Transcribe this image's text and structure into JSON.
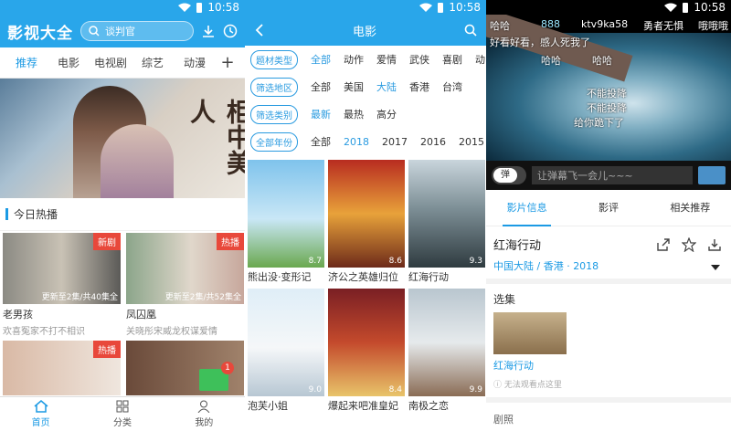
{
  "status": {
    "time": "10:58"
  },
  "home": {
    "logo": "影视大全",
    "search_placeholder": "谈判官",
    "tabs": [
      "推荐",
      "电影",
      "电视剧",
      "综艺",
      "动漫"
    ],
    "plus": "+",
    "section_title": "今日热播",
    "banner_text": "柜中美人",
    "cards": [
      {
        "title": "老男孩",
        "sub": "欢喜冤家不打不相识",
        "badge": "新剧",
        "caption": "更新至2集/共40集全"
      },
      {
        "title": "凤囚凰",
        "sub": "关晓彤宋威龙权谋爱情",
        "badge": "热播",
        "caption": "更新至2集/共52集全"
      },
      {
        "title": "",
        "sub": "",
        "badge": "热播",
        "caption": ""
      },
      {
        "title": "",
        "sub": "",
        "badge": "",
        "caption": ""
      }
    ],
    "mail_badge": "1",
    "nav": [
      "首页",
      "分类",
      "我的"
    ]
  },
  "movies": {
    "title": "电影",
    "filters": [
      {
        "label": "题材类型",
        "options": [
          "全部",
          "动作",
          "爱情",
          "武侠",
          "喜剧",
          "动"
        ],
        "selected": 0
      },
      {
        "label": "筛选地区",
        "options": [
          "全部",
          "美国",
          "大陆",
          "香港",
          "台湾"
        ],
        "selected": 2
      },
      {
        "label": "筛选类别",
        "options": [
          "最新",
          "最热",
          "高分"
        ],
        "selected": 0
      },
      {
        "label": "全部年份",
        "options": [
          "全部",
          "2018",
          "2017",
          "2016",
          "2015"
        ],
        "selected": 1
      }
    ],
    "posters": [
      {
        "title": "熊出没·变形记",
        "score": "8.7"
      },
      {
        "title": "济公之英雄归位",
        "score": "8.6"
      },
      {
        "title": "红海行动",
        "score": "9.3"
      },
      {
        "title": "泡芙小姐",
        "score": "9.0"
      },
      {
        "title": "爆起来吧准皇妃",
        "score": "8.4"
      },
      {
        "title": "南极之恋",
        "score": "9.9"
      }
    ]
  },
  "detail": {
    "danmaku": [
      "哈哈",
      "888",
      "ktv9ka58",
      "勇者无惧",
      "哦哦哦",
      "好看好看，感人死我了",
      "哈哈",
      "哈哈",
      "不能投降",
      "不能投降",
      "给你跪下了"
    ],
    "input_placeholder": "让弹幕飞一会儿~~~",
    "toggle_label": "弹",
    "tabs": [
      "影片信息",
      "影评",
      "相关推荐"
    ],
    "movie_title": "红海行动",
    "meta": "中国大陆 / 香港 · 2018",
    "episodes_label": "选集",
    "episode_title": "红海行动",
    "episode_note": "无法观看点这里",
    "stills_label": "剧照"
  }
}
